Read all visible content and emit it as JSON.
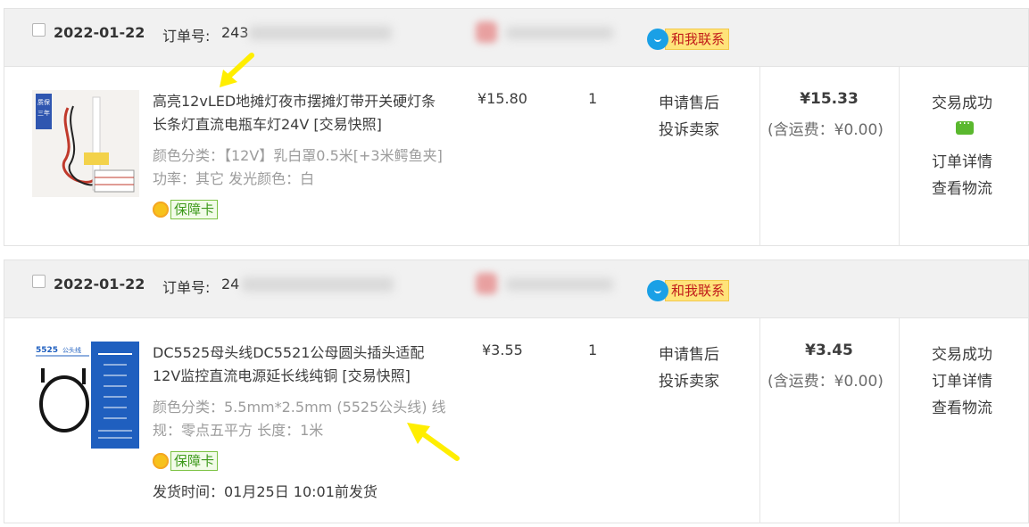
{
  "orders": [
    {
      "date": "2022-01-22",
      "order_no_label": "订单号:",
      "order_no_visible": "243",
      "contact_label": "和我联系",
      "thumb_text": "质保三年",
      "title": "高亮12vLED地摊灯夜市摆摊灯带开关硬灯条长条灯直流电瓶车灯24V [交易快照]",
      "sku": "颜色分类：【12V】乳白罩0.5米[+3米鳄鱼夹] 功率：其它 发光颜色：白",
      "guarantee_label": "保障卡",
      "price": "¥15.80",
      "qty": "1",
      "after_sale": "申请售后",
      "complain": "投诉卖家",
      "total": "¥15.33",
      "shipping": "(含运费：¥0.00)",
      "status": "交易成功",
      "detail": "订单详情",
      "logistics": "查看物流"
    },
    {
      "date": "2022-01-22",
      "order_no_label": "订单号:",
      "order_no_visible": "24",
      "contact_label": "和我联系",
      "thumb_text": "5525公头线",
      "title": "DC5525母头线DC5521公母圆头插头适配12V监控直流电源延长线纯铜 [交易快照]",
      "sku": "颜色分类：5.5mm*2.5mm (5525公头线) 线规：零点五平方 长度：1米",
      "guarantee_label": "保障卡",
      "ship_time": "发货时间：01月25日 10:01前发货",
      "price": "¥3.55",
      "qty": "1",
      "after_sale": "申请售后",
      "complain": "投诉卖家",
      "total": "¥3.45",
      "shipping": "(含运费：¥0.00)",
      "status": "交易成功",
      "detail": "订单详情",
      "logistics": "查看物流"
    }
  ],
  "colors": {
    "header_bg": "#f1f1f1",
    "contact_bubble": "#1aa0e6",
    "contact_bg": "#ffe37a",
    "contact_text": "#c11b1b",
    "guarantee_green": "#3e9a1c",
    "arrow_yellow": "#ffee00"
  }
}
